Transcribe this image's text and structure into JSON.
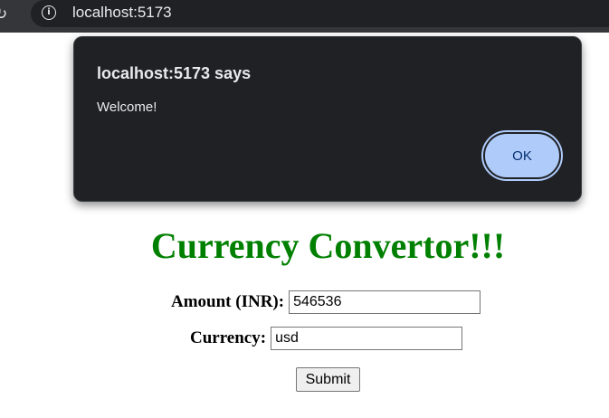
{
  "browser": {
    "url": "localhost:5173"
  },
  "alert": {
    "title": "localhost:5173 says",
    "message": "Welcome!",
    "ok_label": "OK"
  },
  "page": {
    "title": "Currency Convertor!!!",
    "amount_label": "Amount (INR):",
    "amount_value": "546536",
    "currency_label": "Currency:",
    "currency_value": "usd",
    "submit_label": "Submit"
  },
  "colors": {
    "title_green": "#008000",
    "dialog_bg": "#202124",
    "ok_button_bg": "#aecbfa"
  },
  "icons": {
    "reload": "reload-icon",
    "site_info": "info-icon"
  }
}
